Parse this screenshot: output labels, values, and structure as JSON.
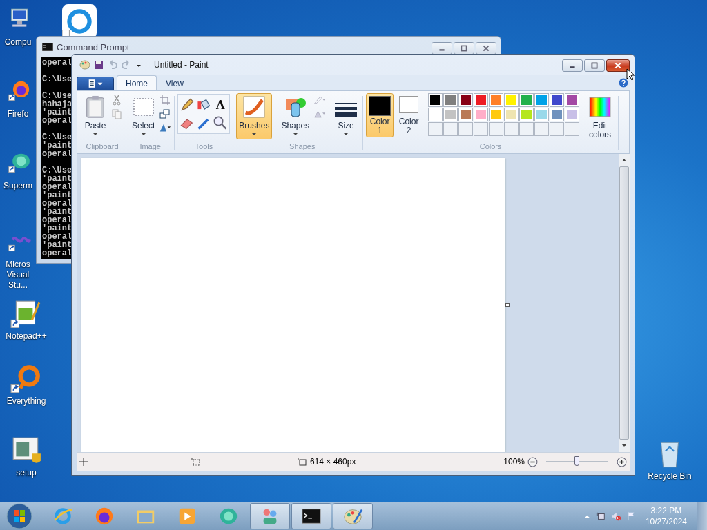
{
  "desktop": {
    "left_column": [
      {
        "kind": "computer",
        "label": "Compu"
      },
      {
        "kind": "firefox",
        "label": "Firefo"
      },
      {
        "kind": "green-app",
        "label": "Superm"
      },
      {
        "kind": "infinity",
        "label": "Micros Visual Stu..."
      },
      {
        "kind": "notepad",
        "label": "Notepad++"
      },
      {
        "kind": "ring",
        "label": "Everything"
      },
      {
        "kind": "setup",
        "label": "setup"
      }
    ],
    "second_column": [
      {
        "kind": "blue-ring"
      }
    ],
    "right_column": [
      {
        "kind": "recycle",
        "label": "Recycle Bin"
      }
    ]
  },
  "command_prompt": {
    "title": "Command Prompt",
    "output_blocks": [
      [
        "operal"
      ],
      [
        "C:\\Use"
      ],
      [
        "C:\\Use",
        "hahaja",
        "'paint",
        "operal"
      ],
      [
        "C:\\Use",
        "'paint",
        "operal"
      ],
      [
        "C:\\Use",
        "'paint",
        "operal",
        "'paint",
        "operal",
        "'paint",
        "operal",
        "'paint",
        "operal",
        "'paint",
        "operal"
      ]
    ]
  },
  "paint": {
    "title": "Untitled - Paint",
    "tabs": [
      {
        "label": "Home",
        "selected": true
      },
      {
        "label": "View",
        "selected": false
      }
    ],
    "groups": [
      {
        "kind": "clipboard",
        "label": "Clipboard",
        "button": "Paste"
      },
      {
        "kind": "image",
        "label": "Image",
        "button": "Select"
      },
      {
        "kind": "tools",
        "label": "Tools",
        "text_tool": "A"
      },
      {
        "kind": "brushes",
        "button": "Brushes",
        "selected": true
      },
      {
        "kind": "shapes",
        "label": "Shapes",
        "button": "Shapes"
      },
      {
        "kind": "size",
        "button": "Size"
      },
      {
        "kind": "colors",
        "label": "Colors"
      }
    ],
    "color_slots": [
      {
        "label": "Color",
        "line2": "1",
        "color": "#000000",
        "selected": true
      },
      {
        "label": "Color",
        "line2": "2",
        "color": "#ffffff",
        "selected": false
      }
    ],
    "palette": [
      {
        "color": "#000000"
      },
      {
        "color": "#7f7f7f"
      },
      {
        "color": "#880015"
      },
      {
        "color": "#ed1c24"
      },
      {
        "color": "#ff7f27"
      },
      {
        "color": "#fff200"
      },
      {
        "color": "#22b14c"
      },
      {
        "color": "#00a2e8"
      },
      {
        "color": "#3f48cc"
      },
      {
        "color": "#a349a4"
      },
      {
        "color": "#ffffff"
      },
      {
        "color": "#c3c3c3"
      },
      {
        "color": "#b97a57"
      },
      {
        "color": "#ffaec9"
      },
      {
        "color": "#ffc90e"
      },
      {
        "color": "#efe4b0"
      },
      {
        "color": "#b5e61d"
      },
      {
        "color": "#99d9ea"
      },
      {
        "color": "#7092be"
      },
      {
        "color": "#c8bfe7"
      }
    ],
    "custom_slots": [
      {
        "kind": "empty"
      },
      {
        "kind": "empty"
      },
      {
        "kind": "empty"
      },
      {
        "kind": "empty"
      },
      {
        "kind": "empty"
      },
      {
        "kind": "empty"
      },
      {
        "kind": "empty"
      },
      {
        "kind": "empty"
      },
      {
        "kind": "empty"
      },
      {
        "kind": "empty"
      }
    ],
    "edit_colors": "Edit colors",
    "status_bar": {
      "image_size": "614 × 460px",
      "zoom": "100%",
      "zoom_level": {
        "level": 0.5
      }
    }
  },
  "taskbar": {
    "items": [
      {
        "kind": "ie",
        "selected": false
      },
      {
        "kind": "firefox",
        "selected": false
      },
      {
        "kind": "folder",
        "selected": false
      },
      {
        "kind": "media",
        "selected": false
      },
      {
        "kind": "green-app",
        "selected": false
      },
      {
        "kind": "people",
        "selected": true
      },
      {
        "kind": "cmd",
        "selected": true
      },
      {
        "kind": "paint",
        "selected": true
      }
    ],
    "time": "3:22 PM",
    "date": "10/27/2024"
  }
}
